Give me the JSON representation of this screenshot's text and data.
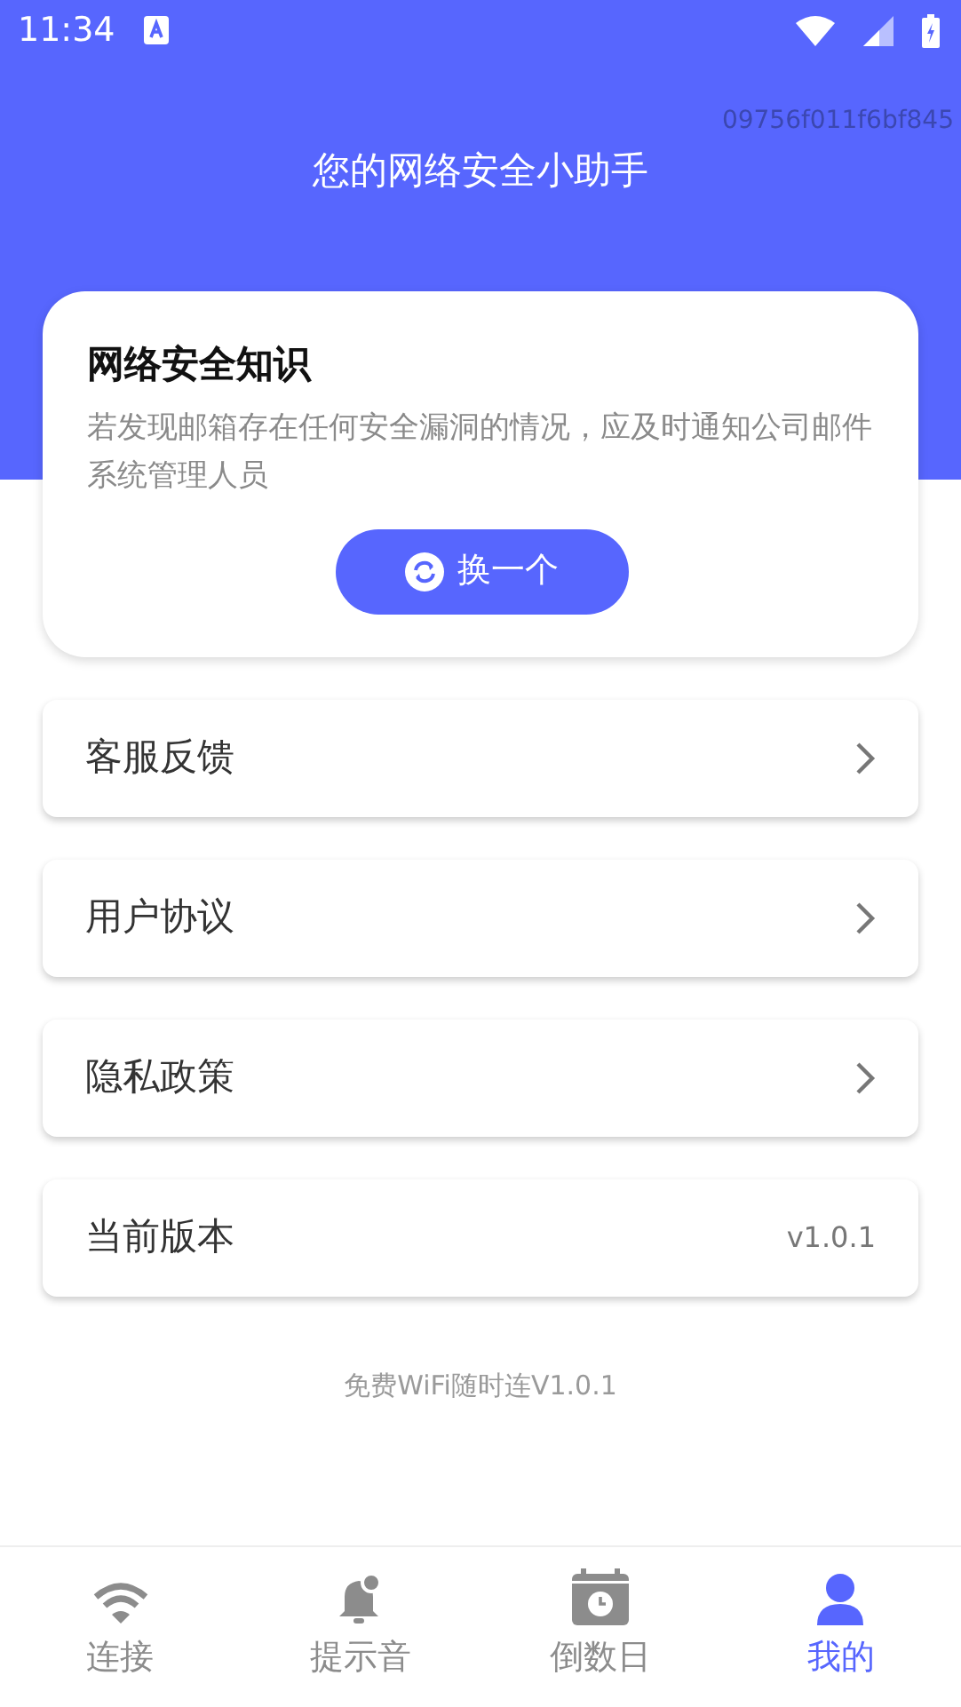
{
  "status_bar": {
    "time": "11:34"
  },
  "header": {
    "title": "您的网络安全小助手",
    "device_id": "09756f011f6bf845"
  },
  "tip_card": {
    "title": "网络安全知识",
    "body": "若发现邮箱存在任何安全漏洞的情况，应及时通知公司邮件系统管理人员",
    "button": "换一个"
  },
  "menu": [
    {
      "kind": "link",
      "label": "客服反馈"
    },
    {
      "kind": "link",
      "label": "用户协议"
    },
    {
      "kind": "link",
      "label": "隐私政策"
    },
    {
      "kind": "value",
      "label": "当前版本",
      "value": "v1.0.1"
    }
  ],
  "footer": "免费WiFi随时连V1.0.1",
  "tabs": [
    {
      "label": "连接",
      "selected": false
    },
    {
      "label": "提示音",
      "selected": false
    },
    {
      "label": "倒数日",
      "selected": false
    },
    {
      "label": "我的",
      "selected": true
    }
  ]
}
